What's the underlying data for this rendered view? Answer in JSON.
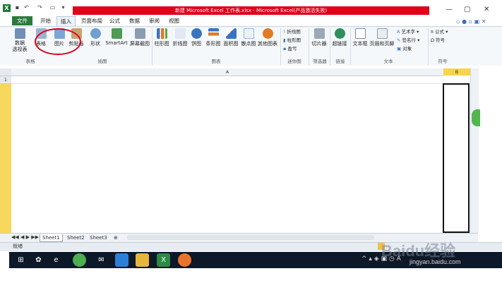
{
  "window": {
    "title": "新建 Microsoft Excel 工作表.xlsx - Microsoft Excel(产品激活失败)",
    "controls": {
      "minimize": "—",
      "maximize": "▢",
      "close": "✕"
    }
  },
  "quick_access": [
    "💾",
    "↶",
    "↷",
    "📂",
    "▾"
  ],
  "tabs": {
    "file": "文件",
    "home": "开始",
    "insert": "插入",
    "page_layout": "页面布局",
    "formulas": "公式",
    "data": "数据",
    "review": "审阅",
    "view": "视图"
  },
  "ribbon": {
    "pivot": "数据\n透视表",
    "table": "表格",
    "picture": "图片",
    "clipart": "剪贴画",
    "shapes": "形状",
    "smartart": "SmartArt",
    "screenshot": "屏幕截图",
    "column": "柱形图",
    "line": "折线图",
    "pie": "饼图",
    "bar": "条形图",
    "area": "面积图",
    "scatter": "散点图",
    "other": "其他图表",
    "spark_line": "折线图",
    "spark_col": "柱形图",
    "spark_wl": "盈亏",
    "slicer": "切片器",
    "hyperlink": "超链接",
    "textbox": "文本框",
    "header_footer": "页眉和页脚",
    "wordart": "艺术字",
    "signature": "签名行",
    "object": "对象",
    "equation": "公式",
    "symbol": "符号"
  },
  "groups": {
    "tables": "表格",
    "illustrations": "插图",
    "charts": "图表",
    "sparklines": "迷你图",
    "filter": "筛选器",
    "links": "链接",
    "text": "文本",
    "symbols": "符号"
  },
  "sheet": {
    "col_a": "A",
    "col_b": "B",
    "row_1": "1",
    "tabs": [
      "Sheet1",
      "Sheet2",
      "Sheet3"
    ]
  },
  "status": "就绪",
  "watermark": {
    "brand": "Baidu经验",
    "url": "jingyan.baidu.com"
  }
}
